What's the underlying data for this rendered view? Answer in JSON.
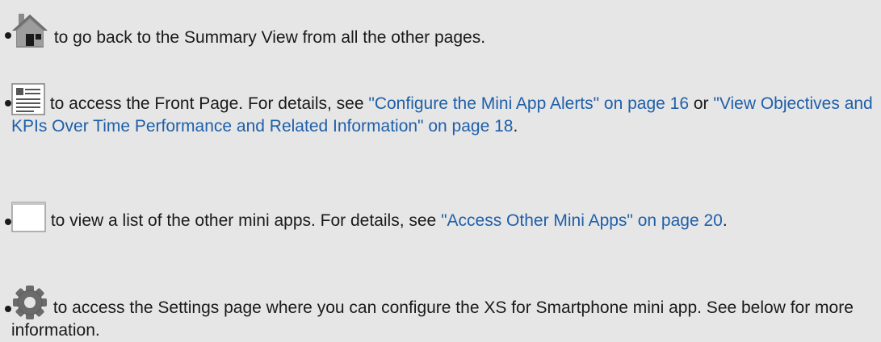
{
  "items": [
    {
      "icon": "home-icon",
      "text": " to go back to the Summary View from all the other pages."
    },
    {
      "icon": "front-page-icon",
      "text_before": " to access the Front Page. For details, see ",
      "link1": "\"Configure the Mini App Alerts\" on page 16",
      "text_or": " or ",
      "link2": "\"View Objectives and KPIs Over Time Performance and Related Information\" on page 18",
      "text_end": "."
    },
    {
      "icon": "folder-icon",
      "text_before": " to view a list of the other mini apps. For details, see ",
      "link1": "\"Access Other Mini Apps\" on page 20",
      "text_end": "."
    },
    {
      "icon": "gear-icon",
      "text": " to access the Settings page where you can configure the XS for Smartphone mini app. See below for more information."
    }
  ]
}
